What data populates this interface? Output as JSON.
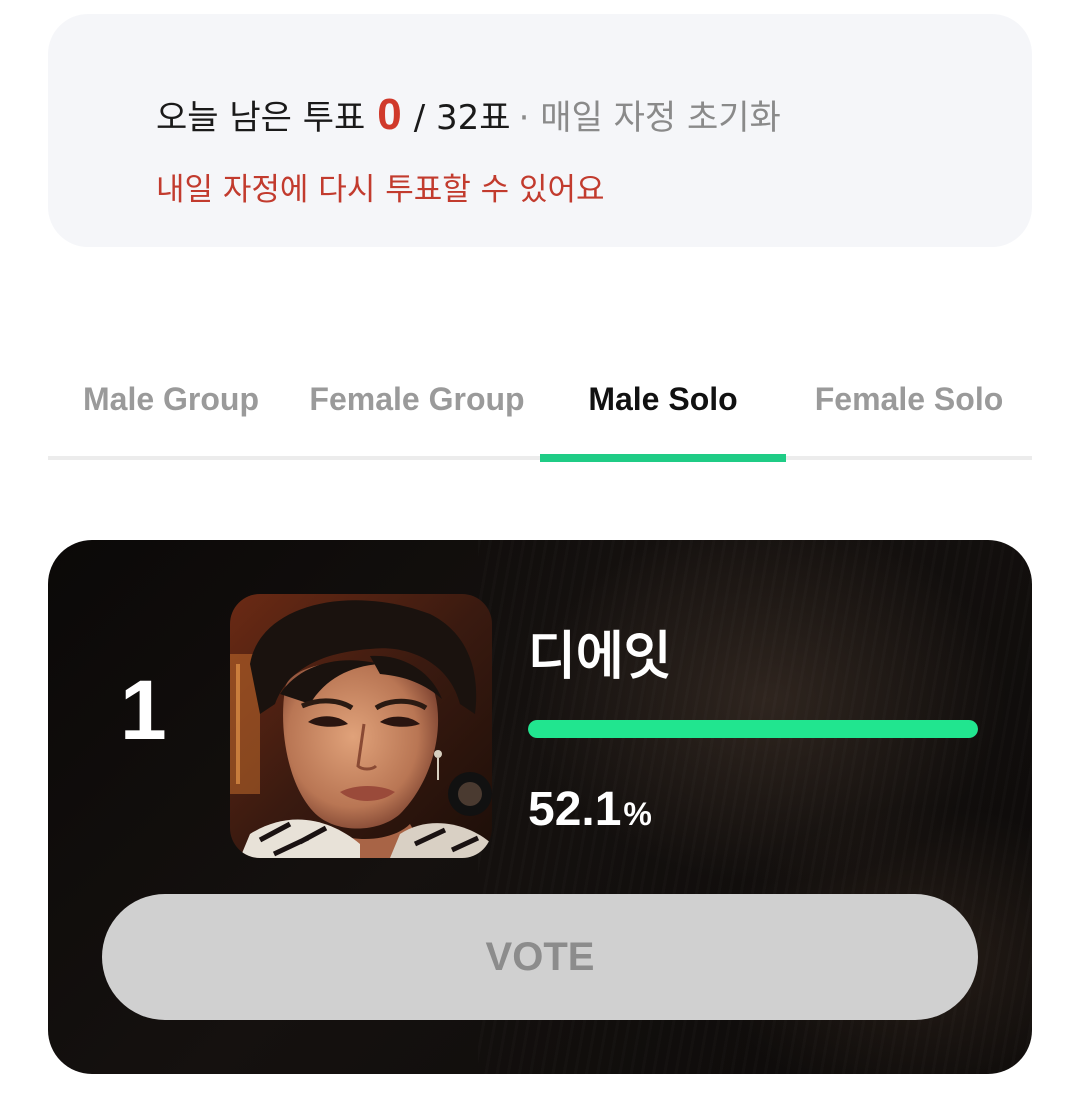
{
  "vote_info": {
    "label": "오늘 남은 투표",
    "remaining": "0",
    "total": "/ 32표",
    "reset_note": "· 매일 자정 초기화",
    "retry_message": "내일 자정에 다시 투표할 수 있어요"
  },
  "tabs": [
    {
      "label": "Male Group",
      "active": false
    },
    {
      "label": "Female Group",
      "active": false
    },
    {
      "label": "Male Solo",
      "active": true
    },
    {
      "label": "Female Solo",
      "active": false
    }
  ],
  "candidate": {
    "rank": "1",
    "name": "디에잇",
    "percent": "52.1",
    "percent_unit": "%",
    "share_fraction": 1.0,
    "vote_label": "VOTE"
  },
  "colors": {
    "accent_green": "#1fcc86",
    "bar_green": "#21e58f",
    "count_red": "#d0392b",
    "message_red": "#c23b2e"
  }
}
